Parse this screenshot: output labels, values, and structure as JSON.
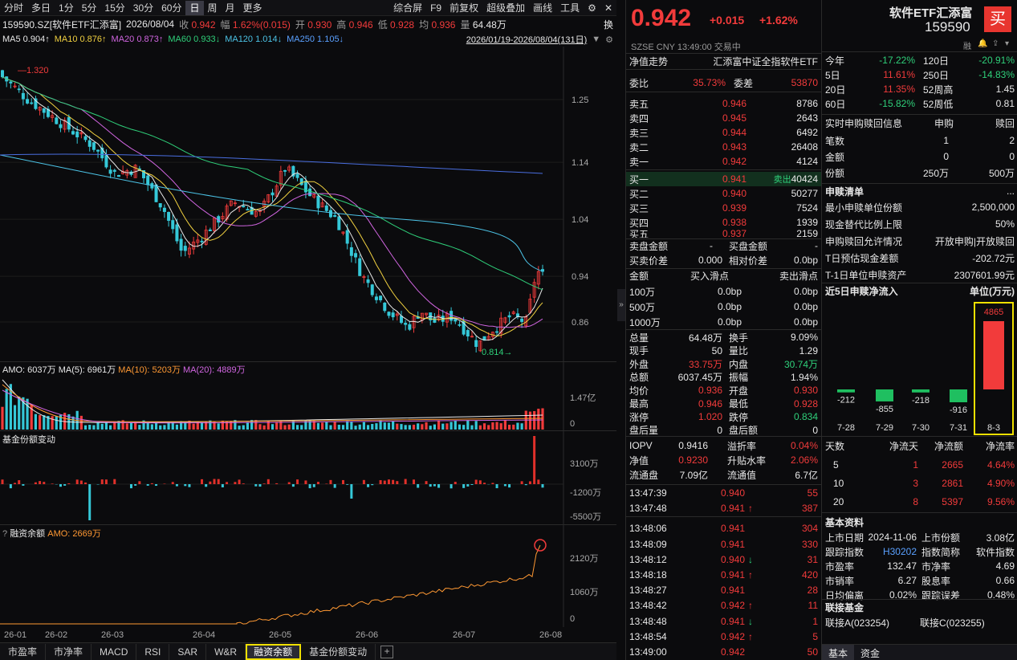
{
  "toolbar": {
    "items": [
      "分时",
      "多日",
      "1分",
      "5分",
      "15分",
      "30分",
      "60分",
      "日",
      "周",
      "月",
      "更多"
    ],
    "active": "日",
    "right": [
      "综合屏",
      "F9",
      "前复权",
      "超级叠加",
      "画线",
      "工具"
    ]
  },
  "info_row": {
    "code": "159590.SZ[软件ETF汇添富]",
    "date": "2026/08/04",
    "close_lbl": "收",
    "close": "0.942",
    "chg_lbl": "幅",
    "chg": "1.62%(0.015)",
    "open_lbl": "开",
    "open": "0.930",
    "high_lbl": "高",
    "high": "0.946",
    "low_lbl": "低",
    "low": "0.928",
    "avg_lbl": "均",
    "avg": "0.936",
    "amt_lbl": "量",
    "amt": "64.48万",
    "switch": "换"
  },
  "ma_row": {
    "ma5": "MA5 0.904↑",
    "ma10": "MA10 0.876↑",
    "ma20": "MA20 0.873↑",
    "ma60": "MA60 0.933↓",
    "ma120": "MA120 1.014↓",
    "ma250": "MA250 1.105↓",
    "range": "2026/01/19-2026/08/04(131日)"
  },
  "kline": {
    "price_axis": [
      "1.25",
      "1.14",
      "1.04",
      "0.94",
      "0.86"
    ],
    "high_mark": "1.320",
    "low_mark": "0.814"
  },
  "amo": {
    "label": "AMO: 6037万",
    "ma5": "MA(5): 6961万",
    "ma10": "MA(10): 5203万",
    "ma20": "MA(20): 4889万",
    "axis": [
      "1.47亿",
      "0"
    ]
  },
  "fund": {
    "label": "基金份额变动",
    "axis": [
      "3100万",
      "-1200万",
      "-5500万"
    ]
  },
  "margin": {
    "q": "?",
    "label": "融资余额",
    "amo": "AMO: 2669万",
    "axis": [
      "2120万",
      "1060万",
      "0"
    ]
  },
  "xaxis": [
    "26-01",
    "26-02",
    "26-03",
    "26-04",
    "26-05",
    "26-06",
    "26-07",
    "26-08"
  ],
  "bottom_tabs": [
    "市盈率",
    "市净率",
    "MACD",
    "RSI",
    "SAR",
    "W&R",
    "融资余额",
    "基金份额变动"
  ],
  "bottom_active": "融资余额",
  "quote": {
    "price": "0.942",
    "chg": "+0.015",
    "pct": "+1.62%",
    "exch": "SZSE",
    "cur": "CNY",
    "time": "13:49:00",
    "status": "交易中",
    "nav_lbl": "净值走势",
    "index_name": "汇添富中证全指软件ETF",
    "wb_lbl": "委比",
    "wb": "35.73%",
    "wc_lbl": "委差",
    "wc": "53870",
    "asks": [
      {
        "l": "卖五",
        "p": "0.946",
        "v": "8786"
      },
      {
        "l": "卖四",
        "p": "0.945",
        "v": "2643"
      },
      {
        "l": "卖三",
        "p": "0.944",
        "v": "6492"
      },
      {
        "l": "卖二",
        "p": "0.943",
        "v": "26408"
      },
      {
        "l": "卖一",
        "p": "0.942",
        "v": "4124"
      }
    ],
    "bids": [
      {
        "l": "买一",
        "p": "0.941",
        "t": "卖出",
        "v": "40424"
      },
      {
        "l": "买二",
        "p": "0.940",
        "v": "50277"
      },
      {
        "l": "买三",
        "p": "0.939",
        "v": "7524"
      },
      {
        "l": "买四",
        "p": "0.938",
        "v": "1939"
      },
      {
        "l": "买五",
        "p": "0.937",
        "v": "2159"
      }
    ],
    "sell_amt_lbl": "卖盘金额",
    "sell_amt": "-",
    "buy_amt_lbl": "买盘金额",
    "buy_amt": "-",
    "bs_spread_lbl": "买卖价差",
    "bs_spread": "0.000",
    "rel_spread_lbl": "相对价差",
    "rel_spread": "0.0bp",
    "slip_hdr": [
      "金额",
      "买入滑点",
      "卖出滑点"
    ],
    "slip": [
      [
        "100万",
        "0.0bp",
        "0.0bp"
      ],
      [
        "500万",
        "0.0bp",
        "0.0bp"
      ],
      [
        "1000万",
        "0.0bp",
        "0.0bp"
      ]
    ],
    "stats": [
      [
        "总量",
        "64.48万",
        "换手",
        "9.09%"
      ],
      [
        "现手",
        "50",
        "量比",
        "1.29"
      ],
      [
        "外盘",
        "33.75万",
        "内盘",
        "30.74万"
      ],
      [
        "总额",
        "6037.45万",
        "振幅",
        "1.94%"
      ],
      [
        "均价",
        "0.936",
        "开盘",
        "0.930"
      ],
      [
        "最高",
        "0.946",
        "最低",
        "0.928"
      ],
      [
        "涨停",
        "1.020",
        "跌停",
        "0.834"
      ],
      [
        "盘后量",
        "0",
        "盘后额",
        "0"
      ]
    ],
    "iopv": [
      [
        "IOPV",
        "0.9416",
        "溢折率",
        "0.04%"
      ],
      [
        "净值",
        "0.9230",
        "升贴水率",
        "2.06%"
      ],
      [
        "流通盘",
        "7.09亿",
        "流通值",
        "6.7亿"
      ]
    ],
    "ticks": [
      [
        "13:47:39",
        "0.940",
        "",
        "55"
      ],
      [
        "13:47:48",
        "0.941",
        "↑",
        "387"
      ],
      [
        "13:48:06",
        "0.941",
        "",
        "304"
      ],
      [
        "13:48:09",
        "0.941",
        "",
        "330"
      ],
      [
        "13:48:12",
        "0.940",
        "↓",
        "31"
      ],
      [
        "13:48:18",
        "0.941",
        "↑",
        "420"
      ],
      [
        "13:48:27",
        "0.941",
        "",
        "28"
      ],
      [
        "13:48:42",
        "0.942",
        "↑",
        "11"
      ],
      [
        "13:48:48",
        "0.941",
        "↓",
        "1"
      ],
      [
        "13:48:54",
        "0.942",
        "↑",
        "5"
      ],
      [
        "13:49:00",
        "0.942",
        "",
        "50"
      ]
    ]
  },
  "info": {
    "name": "软件ETF汇添富",
    "code": "159590",
    "buy": "买",
    "rong": "融",
    "perf": [
      [
        "今年",
        "-17.22%",
        "120日",
        "-20.91%"
      ],
      [
        "5日",
        "11.61%",
        "250日",
        "-14.83%"
      ],
      [
        "20日",
        "11.35%",
        "52周高",
        "1.45"
      ],
      [
        "60日",
        "-15.82%",
        "52周低",
        "0.81"
      ]
    ],
    "sg_hdr": [
      "实时申购赎回信息",
      "申购",
      "赎回"
    ],
    "sg": [
      [
        "笔数",
        "1",
        "2"
      ],
      [
        "金额",
        "0",
        "0"
      ],
      [
        "份额",
        "250万",
        "500万"
      ]
    ],
    "list_title": "申赎清单",
    "more": "...",
    "list": [
      [
        "最小申赎单位份额",
        "2,500,000"
      ],
      [
        "现金替代比例上限",
        "50%"
      ],
      [
        "申购赎回允许情况",
        "开放申购|开放赎回"
      ],
      [
        "T日预估现金差额",
        "-202.72元"
      ],
      [
        "T-1日单位申赎资产",
        "2307601.99元"
      ]
    ],
    "flow_title": "近5日申赎净流入",
    "flow_unit": "单位(万元)",
    "chart_data": {
      "type": "bar",
      "categories": [
        "7-28",
        "7-29",
        "7-30",
        "7-31",
        "8-3"
      ],
      "values": [
        -212,
        -855,
        -218,
        -916,
        4865
      ],
      "title": "近5日申赎净流入",
      "ylabel": "单位(万元)"
    },
    "net_hdr": [
      "天数",
      "净流天",
      "净流额",
      "净流率"
    ],
    "net": [
      [
        "5",
        "1",
        "2665",
        "4.64%"
      ],
      [
        "10",
        "3",
        "2861",
        "4.90%"
      ],
      [
        "20",
        "8",
        "5397",
        "9.56%"
      ]
    ],
    "basic_title": "基本资料",
    "basic": [
      [
        "上市日期",
        "2024-11-06",
        "上市份额",
        "3.08亿"
      ],
      [
        "跟踪指数",
        "H30202",
        "指数简称",
        "软件指数"
      ],
      [
        "市盈率",
        "132.47",
        "市净率",
        "4.69"
      ],
      [
        "市销率",
        "6.27",
        "股息率",
        "0.66"
      ],
      [
        "日均偏离",
        "0.02%",
        "跟踪误差",
        "0.48%"
      ]
    ],
    "link_title": "联接基金",
    "link_a": "联接A(023254)",
    "link_c": "联接C(023255)",
    "tabs": [
      "基本",
      "资金"
    ]
  }
}
